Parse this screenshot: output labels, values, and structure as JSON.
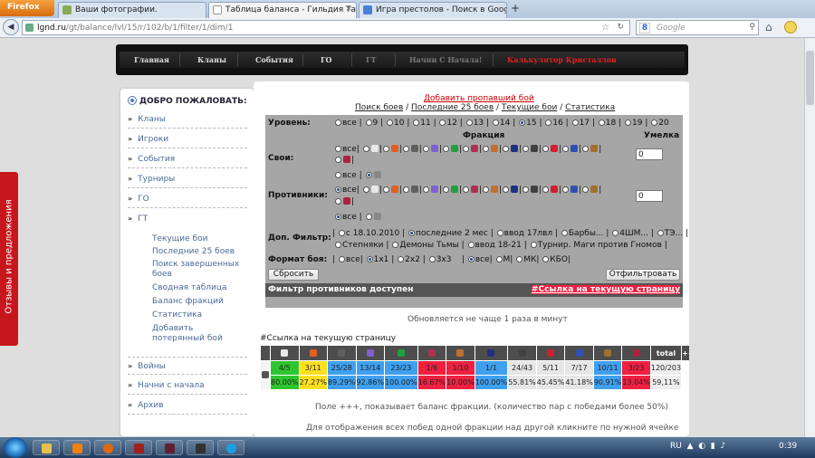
{
  "browser": {
    "menu_button": "Firefox",
    "tabs": [
      {
        "title": "Ваши фотографии.",
        "active": false
      },
      {
        "title": "Таблица баланса - Гильдия Тактико...",
        "active": true
      },
      {
        "title": "Игра престолов - Поиск в Google",
        "active": false
      }
    ],
    "url_host": "lgnd.ru",
    "url_path": "/gt/balance/lvl/15/r/102/b/1/filter/1/dim/1",
    "search_placeholder": "Google"
  },
  "feedback_tab": "Отзывы и предложения",
  "top_menu": [
    {
      "label": "Главная",
      "style": "normal"
    },
    {
      "label": "Кланы",
      "style": "normal"
    },
    {
      "label": "События",
      "style": "normal"
    },
    {
      "label": "ГО",
      "style": "normal"
    },
    {
      "label": "ГТ",
      "style": "dim"
    },
    {
      "label": "Начни С Начала!",
      "style": "dim"
    },
    {
      "label": "Калькулятор Кристаллов",
      "style": "red"
    }
  ],
  "sidebar": {
    "welcome": "ДОБРО ПОЖАЛОВАТЬ:",
    "items": [
      "Кланы",
      "Игроки",
      "События",
      "Турниры",
      "ГО",
      "ГТ"
    ],
    "sub_items": [
      "Текущие бои",
      "Последние 25 боев",
      "Поиск завершенных боев",
      "Сводная таблица",
      "Баланс фракций",
      "Статистика",
      "Добавить потерянный бой"
    ],
    "items_bottom": [
      "Войны",
      "Начни с начала",
      "Архив"
    ]
  },
  "main": {
    "add_link": "Добавить пропавший бой",
    "links": [
      "Поиск боев",
      "Последние 25 боев",
      "Текущие бои",
      "Статистика"
    ],
    "filter": {
      "level_label": "Уровень:",
      "levels": [
        "все",
        "9",
        "10",
        "11",
        "12",
        "13",
        "14",
        "15",
        "16",
        "17",
        "18",
        "19",
        "20"
      ],
      "selected_level": "15",
      "faction_header": "Фракция",
      "rating_header": "Умелка",
      "own_label": "Свои:",
      "opp_label": "Противники:",
      "own_rating": "0",
      "opp_rating": "0",
      "all": "все",
      "extra_label": "Доп. Фильтр:",
      "extra_options_1": [
        "с 18.10.2010",
        "последние 2 мес",
        "ввод 17лвл",
        "Барбы...",
        "4ШМ...",
        "ТЭ..."
      ],
      "extra_options_2": [
        "Степняки",
        "Демоны Тьмы",
        "ввод 18-21",
        "Турнир. Маги против Гномов"
      ],
      "format_label": "Формат боя:",
      "format_options": [
        "все",
        "1х1",
        "2х2",
        "3х3"
      ],
      "mode_options": [
        "все",
        "М",
        "МК",
        "КБО"
      ],
      "reset": "Сбросить",
      "apply": "Отфильтровать",
      "bar_text": "Фильтр противников доступен",
      "bar_link": "#Ссылка на текущую страницу"
    },
    "update_note": "Обновляется не чаще 1 раза в минут",
    "current_link": "#Ссылка на текущую страницу",
    "table": {
      "header_total": "total",
      "header_plus": "+++",
      "wins": [
        "4/5",
        "3/11",
        "25/28",
        "13/14",
        "23/23",
        "1/6",
        "1/10",
        "1/1",
        "24/43",
        "5/11",
        "7/17",
        "10/11",
        "3/23"
      ],
      "percents": [
        "80.00%",
        "27.27%",
        "89.29%",
        "92.86%",
        "100.00%",
        "16.67%",
        "10.00%",
        "100.00%",
        "55.81%",
        "45.45%",
        "41.18%",
        "90.91%",
        "13.04%"
      ],
      "colors": [
        "g",
        "y",
        "b",
        "b",
        "b",
        "r",
        "r",
        "b",
        "w",
        "w",
        "w",
        "b",
        "r"
      ],
      "icon_colors": [
        "#e8e8e8",
        "#e06020",
        "#606060",
        "#8060d0",
        "#20a040",
        "#b03050",
        "#c07030",
        "#203080",
        "#404040",
        "#d02030",
        "#3050b0",
        "#a07030",
        "#b02040"
      ],
      "total_wins": "120/203",
      "total_pct": "59,11%",
      "plus": "7"
    },
    "note1": "Поле +++, показывает баланс фракции. (количество пар с победами более 50%)",
    "note2": "Для отображения всех побед одной фракции над другой кликните по нужной ячейке"
  },
  "taskbar": {
    "lang": "RU",
    "time": "0:39"
  }
}
